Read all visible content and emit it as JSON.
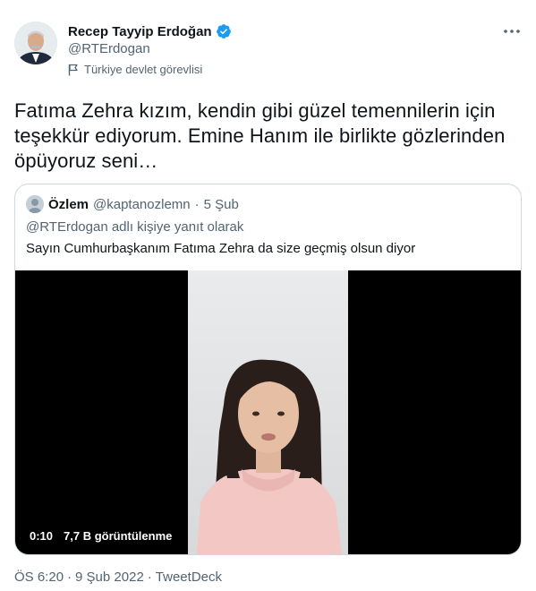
{
  "author": {
    "display_name": "Recep Tayyip Erdoğan",
    "handle": "@RTErdogan",
    "label": "Türkiye devlet görevlisi",
    "verified_icon": "verified-badge-icon",
    "more_icon": "more-icon"
  },
  "tweet": {
    "text": "Fatıma Zehra kızım, kendin gibi güzel temennilerin için teşekkür ediyorum. Emine Hanım ile birlikte gözlerinden öpüyoruz seni…"
  },
  "quote": {
    "name": "Özlem",
    "handle": "@kaptanozlemn",
    "separator": "·",
    "date": "5 Şub",
    "reply_to": "@RTErdogan adlı kişiye yanıt olarak",
    "text": "Sayın Cumhurbaşkanım Fatıma Zehra da size geçmiş olsun diyor",
    "video": {
      "duration": "0:10",
      "views": "7,7 B görüntülenme"
    }
  },
  "footer": {
    "time": "ÖS 6:20",
    "separator1": "·",
    "date": "9 Şub 2022",
    "separator2": "·",
    "source": "TweetDeck"
  },
  "colors": {
    "verified": "#1d9bf0",
    "secondary_text": "#536471",
    "border": "#cfd9de"
  }
}
